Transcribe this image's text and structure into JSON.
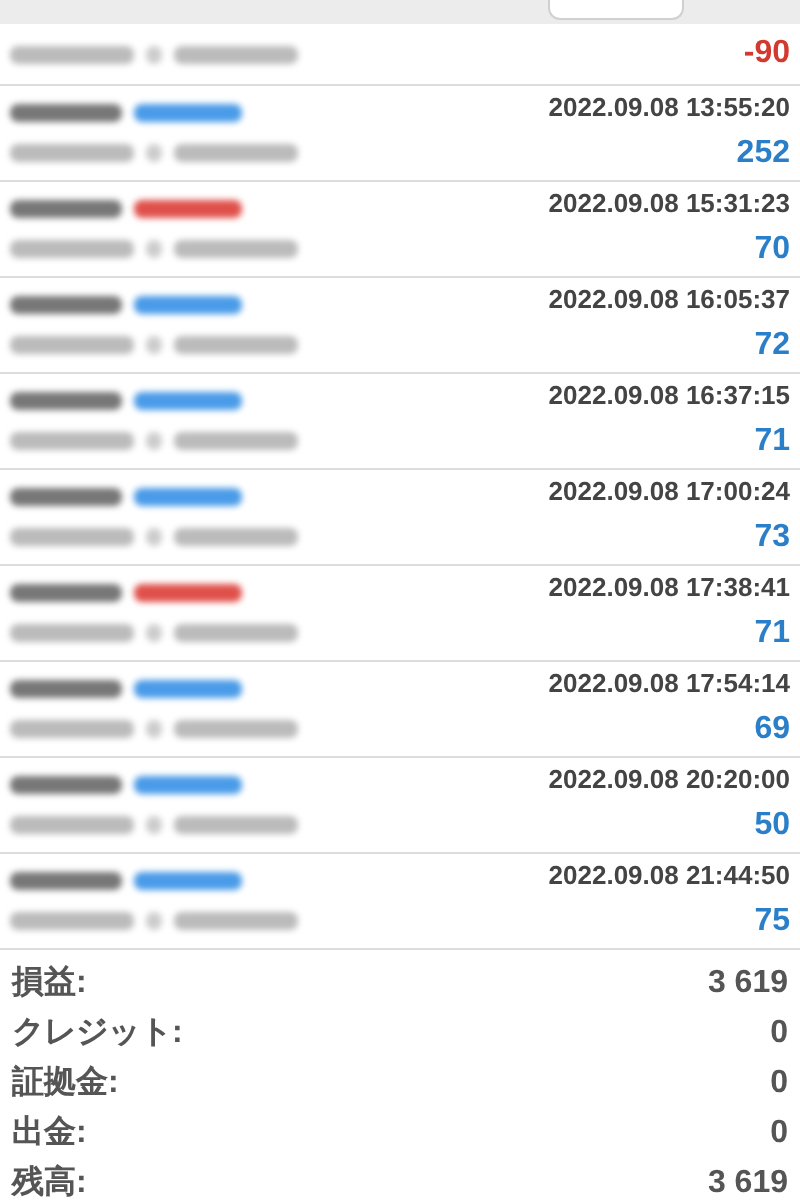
{
  "trades": [
    {
      "kind": "partial",
      "profit": "-90",
      "loss": true
    },
    {
      "kind": "buy",
      "time": "2022.09.08 13:55:20",
      "profit": "252",
      "loss": false
    },
    {
      "kind": "sell",
      "time": "2022.09.08 15:31:23",
      "profit": "70",
      "loss": false
    },
    {
      "kind": "buy",
      "time": "2022.09.08 16:05:37",
      "profit": "72",
      "loss": false
    },
    {
      "kind": "buy",
      "time": "2022.09.08 16:37:15",
      "profit": "71",
      "loss": false
    },
    {
      "kind": "buy",
      "time": "2022.09.08 17:00:24",
      "profit": "73",
      "loss": false
    },
    {
      "kind": "sell",
      "time": "2022.09.08 17:38:41",
      "profit": "71",
      "loss": false
    },
    {
      "kind": "buy",
      "time": "2022.09.08 17:54:14",
      "profit": "69",
      "loss": false
    },
    {
      "kind": "buy",
      "time": "2022.09.08 20:20:00",
      "profit": "50",
      "loss": false
    },
    {
      "kind": "buy",
      "time": "2022.09.08 21:44:50",
      "profit": "75",
      "loss": false
    }
  ],
  "summary": [
    {
      "label": "損益:",
      "value": "3 619"
    },
    {
      "label": "クレジット:",
      "value": "0"
    },
    {
      "label": "証拠金:",
      "value": "0"
    },
    {
      "label": "出金:",
      "value": "0"
    },
    {
      "label": "残高:",
      "value": "3 619"
    }
  ]
}
